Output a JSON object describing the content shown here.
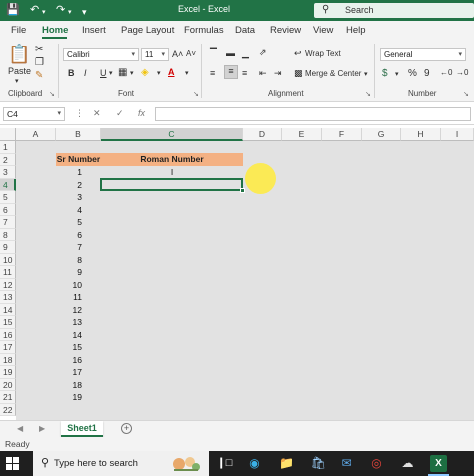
{
  "titlebar": {
    "title": "Excel - Excel",
    "search_placeholder": "Search",
    "autosave_icon": "save-icon",
    "undo_icon": "undo-icon",
    "redo_icon": "redo-icon"
  },
  "menu": {
    "tabs": [
      "File",
      "Home",
      "Insert",
      "Page Layout",
      "Formulas",
      "Data",
      "Review",
      "View",
      "Help"
    ],
    "active": "Home"
  },
  "ribbon": {
    "clipboard": {
      "paste_label": "Paste",
      "group_label": "Clipboard"
    },
    "font": {
      "font_name": "Calibri",
      "font_size": "11",
      "bold": "B",
      "italic": "I",
      "underline": "U",
      "grow": "A˄",
      "shrink": "A˅",
      "font_color": "A",
      "group_label": "Font"
    },
    "alignment": {
      "wrap_text": "Wrap Text",
      "merge_center": "Merge & Center",
      "group_label": "Alignment"
    },
    "number": {
      "format": "General",
      "currency": "$",
      "percent": "%",
      "comma": "9",
      "group_label": "Number"
    }
  },
  "formula_bar": {
    "name_box": "C4",
    "cancel": "✕",
    "enter": "✓",
    "fx": "fx",
    "formula": ""
  },
  "grid": {
    "columns": [
      "A",
      "B",
      "C",
      "D",
      "E",
      "F",
      "G",
      "H",
      "I"
    ],
    "rows": [
      "1",
      "2",
      "3",
      "4",
      "5",
      "6",
      "7",
      "8",
      "9",
      "10",
      "11",
      "12",
      "13",
      "14",
      "15",
      "16",
      "17",
      "18",
      "19",
      "20",
      "21",
      "22"
    ],
    "selected_column": "C",
    "selected_row": "4",
    "header_sr": "Sr Number",
    "header_roman": "Roman Number",
    "header_fill": "#f4b183",
    "sr_numbers": [
      "1",
      "2",
      "3",
      "4",
      "5",
      "6",
      "7",
      "8",
      "9",
      "10",
      "11",
      "12",
      "13",
      "14",
      "15",
      "16",
      "17",
      "18",
      "19"
    ],
    "roman_c3": "I"
  },
  "sheets": {
    "tabs": [
      "Sheet1"
    ],
    "active": "Sheet1",
    "add_label": "+"
  },
  "status": {
    "ready": "Ready"
  },
  "taskbar": {
    "search_text": "Type here to search",
    "icons": [
      "task-view-icon",
      "edge-icon",
      "file-explorer-icon",
      "mail-icon",
      "chrome-icon",
      "photos-icon",
      "excel-icon"
    ]
  },
  "colors": {
    "accent": "#217346",
    "highlight": "#ffeb3c"
  }
}
